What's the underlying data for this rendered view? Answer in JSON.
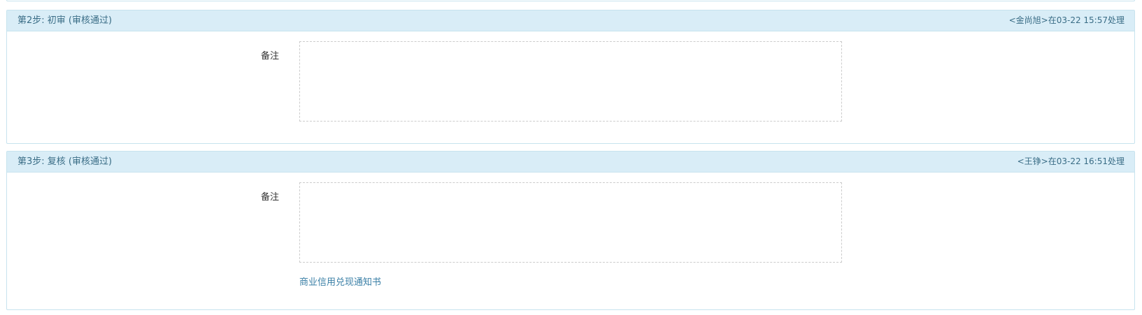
{
  "steps": [
    {
      "title": "第2步: 初审 (审核通过)",
      "meta": "<金尚旭>在03-22 15:57处理",
      "remark_label": "备注",
      "remark_value": ""
    },
    {
      "title": "第3步: 复核 (审核通过)",
      "meta": "<王铮>在03-22 16:51处理",
      "remark_label": "备注",
      "remark_value": "",
      "attachment_link": "商业信用兑现通知书"
    }
  ],
  "colors": {
    "header_bg": "#d9edf7",
    "border": "#c7e3ee",
    "header_text": "#3a6d86",
    "link": "#3a7fa6"
  }
}
